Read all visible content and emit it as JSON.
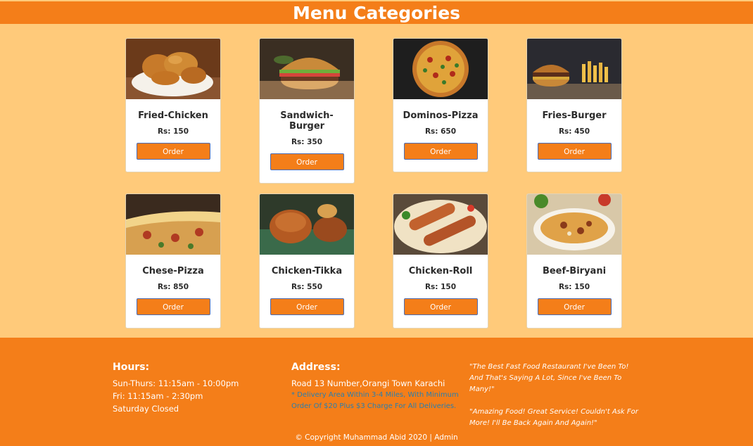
{
  "header": {
    "title": "Menu Categories"
  },
  "menu": {
    "items": [
      {
        "name": "Fried-Chicken",
        "price": "Rs: 150",
        "order_label": "Order",
        "image": "fried-chicken-photo"
      },
      {
        "name": "Sandwich-Burger",
        "price": "Rs: 350",
        "order_label": "Order",
        "image": "sandwich-burger-photo"
      },
      {
        "name": "Dominos-Pizza",
        "price": "Rs: 650",
        "order_label": "Order",
        "image": "dominos-pizza-photo"
      },
      {
        "name": "Fries-Burger",
        "price": "Rs: 450",
        "order_label": "Order",
        "image": "fries-burger-photo"
      },
      {
        "name": "Chese-Pizza",
        "price": "Rs: 850",
        "order_label": "Order",
        "image": "cheese-pizza-photo"
      },
      {
        "name": "Chicken-Tikka",
        "price": "Rs: 550",
        "order_label": "Order",
        "image": "chicken-tikka-photo"
      },
      {
        "name": "Chicken-Roll",
        "price": "Rs: 150",
        "order_label": "Order",
        "image": "chicken-roll-photo"
      },
      {
        "name": "Beef-Biryani",
        "price": "Rs: 150",
        "order_label": "Order",
        "image": "beef-biryani-photo"
      }
    ]
  },
  "footer": {
    "hours": {
      "heading": "Hours:",
      "lines": [
        "Sun-Thurs: 11:15am - 10:00pm",
        "Fri: 11:15am - 2:30pm",
        "Saturday Closed"
      ]
    },
    "address": {
      "heading": "Address:",
      "line": "Road 13 Number,Orangi Town Karachi",
      "note": "* Delivery Area Within 3-4 Miles, With Minimum Order Of $20 Plus $3 Charge For All Deliveries."
    },
    "quotes": [
      "\"The Best Fast Food Restaurant I've Been To! And That's Saying A Lot, Since I've Been To Many!\"",
      "\"Amazing Food! Great Service! Couldn't Ask For More! I'll Be Back Again And Again!\""
    ],
    "copyright": "© Copyright Muhammad Abid 2020 | Admin"
  },
  "colors": {
    "accent": "#f47e19",
    "background": "#ffca7a",
    "card": "#ffffff",
    "note_text": "#2a7fae"
  }
}
